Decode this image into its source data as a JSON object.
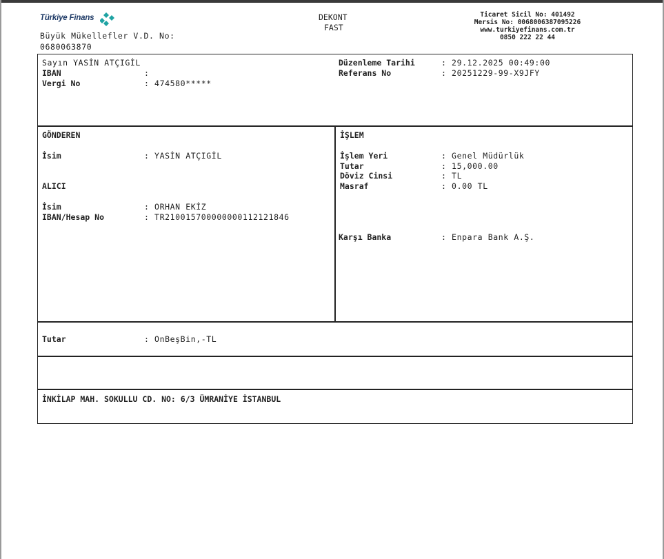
{
  "header": {
    "bank_name": "Türkiye Finans",
    "tax_office_line1": "Büyük Mükellefler V.D. No:",
    "tax_office_line2": "0680063870",
    "doc_title": "DEKONT",
    "doc_subtitle": "FAST",
    "registry_lines": [
      "Ticaret Sicil No: 401492",
      "Mersis No: 0068006387095226",
      "www.turkiyefinans.com.tr",
      "0850 222 22 44"
    ]
  },
  "customer": {
    "greeting": "Sayın YASİN ATÇIGİL",
    "iban_label": "IBAN",
    "iban_value": ":",
    "tax_label": "Vergi No",
    "tax_value": ": 474580*****",
    "date_label": "Düzenleme Tarihi",
    "date_value": ": 29.12.2025 00:49:00",
    "ref_label": "Referans No",
    "ref_value": ": 20251229-99-X9JFY"
  },
  "sender": {
    "section_title": "GÖNDEREN",
    "name_label": "İsim",
    "name_value": ": YASİN ATÇIGİL"
  },
  "receiver": {
    "section_title": "ALICI",
    "name_label": "İsim",
    "name_value": ": ORHAN EKİZ",
    "iban_label": "IBAN/Hesap No",
    "iban_value": ": TR210015700000000112121846"
  },
  "transaction": {
    "section_title": "İŞLEM",
    "place_label": "İşlem Yeri",
    "place_value": ": Genel Müdürlük",
    "amount_label": "Tutar",
    "amount_value": ": 15,000.00",
    "currency_label": "Döviz Cinsi",
    "currency_value": ": TL",
    "fee_label": "Masraf",
    "fee_value": ": 0.00 TL",
    "bank_label": "Karşı Banka",
    "bank_value": ": Enpara Bank A.Ş."
  },
  "amount_words": {
    "label": "Tutar",
    "value": ": OnBeşBin,-TL"
  },
  "footer": {
    "address": "İNKİLAP MAH. SOKULLU CD. NO: 6/3 ÜMRANİYE İSTANBUL"
  },
  "colors": {
    "logo_teal": "#1fa3a3",
    "logo_navy": "#1e3a66"
  }
}
